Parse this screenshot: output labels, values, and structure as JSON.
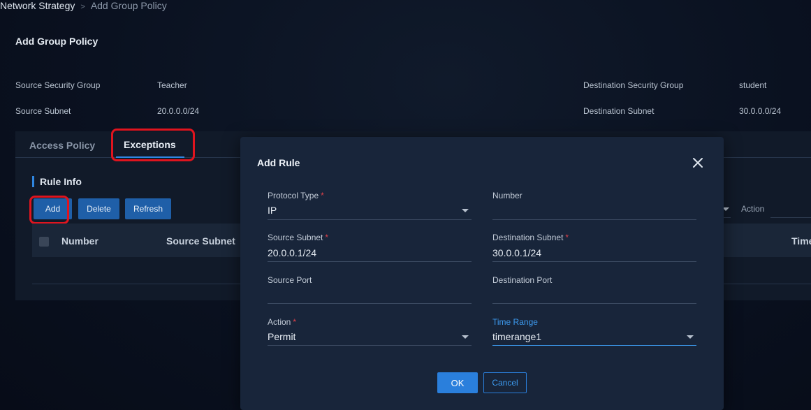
{
  "breadcrumb": {
    "parent": "Network Strategy",
    "separator": ">",
    "current": "Add Group Policy"
  },
  "page_title": "Add Group Policy",
  "info": {
    "source_security_group_label": "Source Security Group",
    "source_security_group_value": "Teacher",
    "destination_security_group_label": "Destination Security Group",
    "destination_security_group_value": "student",
    "source_subnet_label": "Source Subnet",
    "source_subnet_value": "20.0.0.0/24",
    "destination_subnet_label": "Destination Subnet",
    "destination_subnet_value": "30.0.0.0/24"
  },
  "tabs": [
    {
      "label": "Access Policy"
    },
    {
      "label": "Exceptions"
    }
  ],
  "rule_info": {
    "title": "Rule Info",
    "buttons": {
      "add": "Add",
      "delete": "Delete",
      "refresh": "Refresh"
    },
    "filter_label": "Action",
    "columns": [
      "Number",
      "Source Subnet",
      "Time"
    ]
  },
  "modal": {
    "title": "Add Rule",
    "ok": "OK",
    "cancel": "Cancel",
    "fields": {
      "protocol_type": {
        "label": "Protocol Type",
        "required": "*",
        "value": "IP"
      },
      "number": {
        "label": "Number",
        "value": ""
      },
      "source_subnet": {
        "label": "Source Subnet",
        "required": "*",
        "value": "20.0.0.1/24"
      },
      "destination_subnet": {
        "label": "Destination Subnet",
        "required": "*",
        "value": "30.0.0.1/24"
      },
      "source_port": {
        "label": "Source Port",
        "value": ""
      },
      "destination_port": {
        "label": "Destination Port",
        "value": ""
      },
      "action": {
        "label": "Action",
        "required": "*",
        "value": "Permit"
      },
      "time_range": {
        "label": "Time Range",
        "value": "timerange1"
      }
    }
  },
  "colors": {
    "accent": "#2f86e0",
    "highlight_box": "#e0141e",
    "required": "#e0414a"
  }
}
